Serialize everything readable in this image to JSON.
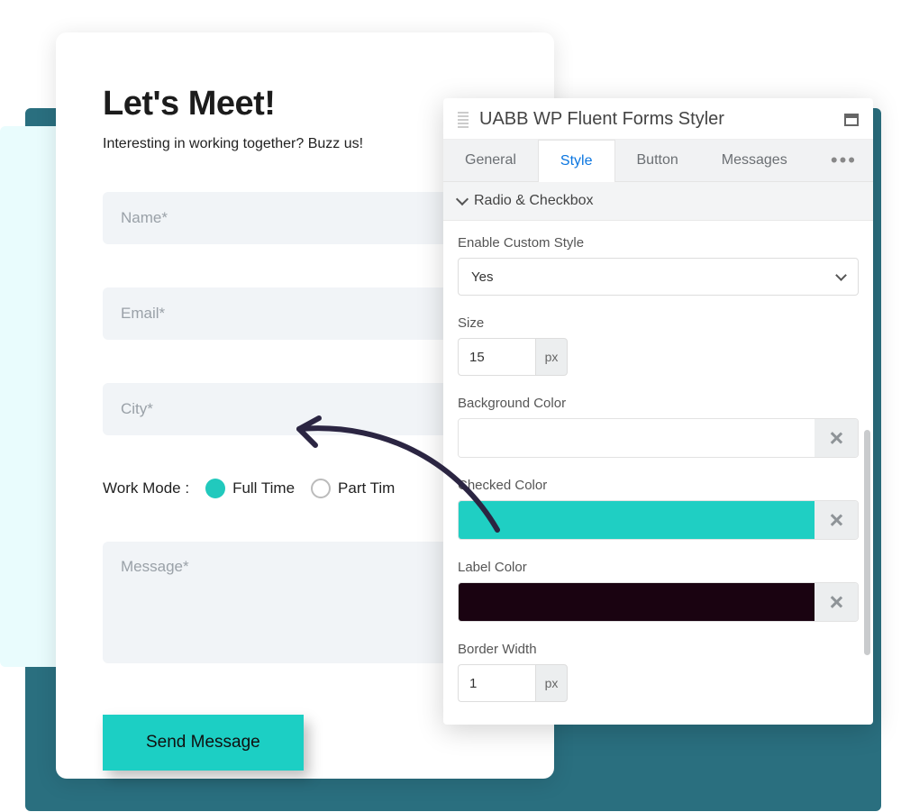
{
  "form": {
    "title": "Let's Meet!",
    "subtitle": "Interesting in working together? Buzz us!",
    "name_placeholder": "Name*",
    "email_placeholder": "Email*",
    "city_placeholder": "City*",
    "workmode_label": "Work Mode :",
    "radio_fulltime": "Full Time",
    "radio_parttime": "Part Tim",
    "message_placeholder": "Message*",
    "submit_label": "Send Message"
  },
  "panel": {
    "title": "UABB WP Fluent Forms Styler",
    "tabs": {
      "general": "General",
      "style": "Style",
      "button": "Button",
      "messages": "Messages"
    },
    "section_title": "Radio & Checkbox",
    "fields": {
      "enable_custom_label": "Enable Custom Style",
      "enable_custom_value": "Yes",
      "size_label": "Size",
      "size_value": "15",
      "size_unit": "px",
      "bgcolor_label": "Background Color",
      "bgcolor_value": "#ffffff",
      "checkedcolor_label": "Checked Color",
      "checkedcolor_value": "#1fcfc3",
      "labelcolor_label": "Label Color",
      "labelcolor_value": "#1a0311",
      "borderwidth_label": "Border Width",
      "borderwidth_value": "1",
      "borderwidth_unit": "px"
    }
  }
}
